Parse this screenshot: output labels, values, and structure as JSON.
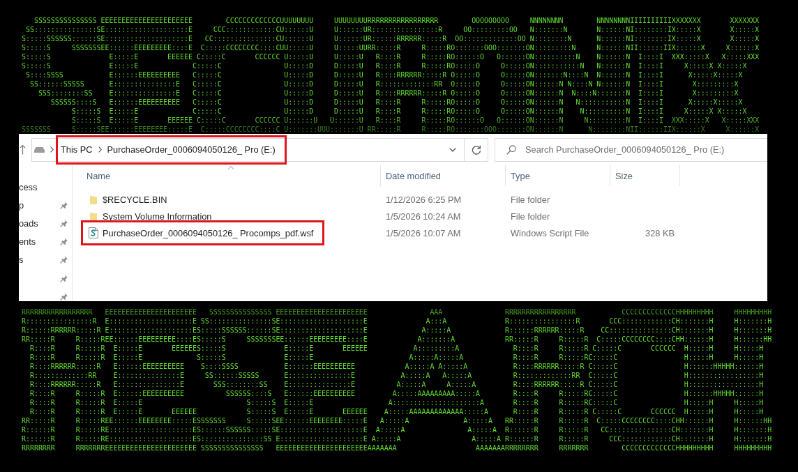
{
  "ascii_art_top": {
    "lines": [
      "   SSSSSSSSSSSSSSS EEEEEEEEEEEEEEEEEEEEEE        CCCCCCCCCCCCCUUUUUUUU     UUUUUUUURRRRRRRRRRRRRRRRR        OOOOOOOOO     NNNNNNNN        NNNNNNNNIIIIIIIIIIXXXXXXX       XXXXXXX",
      " SS:::::::::::::::SE::::::::::::::::::::E     CCC::::::::::::CU::::::U     U::::::UR::::::::::::::::R     OO:::::::::OO   N:::::::N       N::::::NI::::::::IX:::::X       X:::::X",
      "S:::::SSSSSS::::::SE::::::::::::::::::::E   CC:::::::::::::::CU::::::U     U::::::UR::::::RRRRRR:::::R  OO:::::::::::::OO N::::::::N      N::::::NI::::::::IX:::::X       X:::::X",
      "S:::::S     SSSSSSSEE::::::EEEEEEEEE::::E  C:::::CCCCCCCC::::CUU:::::U     U:::::UURR:::::R     R:::::RO:::::::OOO:::::::ON:::::::::N     N::::::NII::::::IIX::::::X     X::::::X",
      "S:::::S              E:::::E       EEEEEE C:::::C       CCCCCC U:::::U     U:::::U   R::::R     R:::::RO::::::O   O::::::ON::::::::::N    N::::::N  I::::I  XXX:::::X   X:::::XXX",
      "S:::::S              E:::::E             C:::::C               U:::::D     D:::::U   R::::R     R:::::RO:::::O     O:::::ON:::::::::::N   N::::::N  I::::I     X:::::X X:::::X",
      " S::::SSSS           E::::::EEEEEEEEEE   C:::::C               U:::::D     D:::::U   R::::RRRRRR:::::R O:::::O     O:::::ON:::::::N::::N  N::::::N  I::::I      X:::::X:::::X",
      "  SS::::::SSSSS      E:::::::::::::::E   C:::::C               U:::::D     D:::::U   R:::::::::::::RR  O:::::O     O:::::ON::::::N N::::N N::::::N  I::::I       X:::::::::X",
      "    SSS::::::::SS    E:::::::::::::::E   C:::::C               U:::::D     D:::::U   R::::RRRRRR:::::R O:::::O     O:::::ON::::::N  N::::N:::::::N  I::::I       X:::::::::X",
      "       SSSSSS::::S   E::::::EEEEEEEEEE   C:::::C               U:::::D     D:::::U   R::::R     R:::::RO:::::O     O:::::ON::::::N   N:::::::::::N  I::::I      X:::::X:::::X",
      "            S:::::S  E:::::E             C:::::C               U:::::D     D:::::U   R::::R     R:::::RO:::::O     O:::::ON::::::N    N::::::::::N  I::::I     X:::::X X:::::X",
      "            S:::::S  E:::::E       EEEEEE C:::::C       CCCCCC U::::::U   U::::::U   R::::R     R:::::RO::::::O   O::::::ON::::::N     N:::::::::N  I::::I  XXX:::::X   X:::::XXX",
      "SSSSSSS     S:::::SEE::::::EEEEEEEE:::::E  C:::::CCCCCCCC::::C U:::::::UUU:::::::U RR:::::R     R:::::RO:::::::OOO:::::::ON::::::N      N::::::::NII::::::IIX::::::X     X::::::X"
    ]
  },
  "explorer": {
    "address_bar": {
      "highlighted": true,
      "breadcrumbs": [
        "This PC",
        "PurchaseOrder_0006094050126_ Pro (E:)"
      ]
    },
    "search": {
      "placeholder": "Search PurchaseOrder_0006094050126_ Pro (E:)"
    },
    "navigation_pane": {
      "items": [
        {
          "label": "cess",
          "pinned": false
        },
        {
          "label": "p",
          "pinned": true
        },
        {
          "label": "oads",
          "pinned": true
        },
        {
          "label": "ents",
          "pinned": true
        },
        {
          "label": "s",
          "pinned": true
        },
        {
          "pinned": true
        },
        {
          "pinned": true
        }
      ]
    },
    "columns": [
      {
        "label": "Name",
        "sorted": true
      },
      {
        "label": "Date modified",
        "sorted": false
      },
      {
        "label": "Type",
        "sorted": false
      },
      {
        "label": "Size",
        "sorted": false
      }
    ],
    "files": [
      {
        "kind": "folder",
        "name": "$RECYCLE.BIN",
        "date_modified": "1/12/2026 6:25 PM",
        "type": "File folder",
        "highlighted": false
      },
      {
        "kind": "folder",
        "name": "System Volume Information",
        "date_modified": "1/5/2026 10:24 AM",
        "type": "File folder",
        "highlighted": false
      },
      {
        "kind": "script",
        "name": "PurchaseOrder_0006094050126_ Procomps_pdf.wsf",
        "date_modified": "1/5/2026 10:07 AM",
        "type": "Windows Script File",
        "size": "328 KB",
        "highlighted": true
      }
    ]
  },
  "ascii_art_bottom": {
    "lines": [
      "RRRRRRRRRRRRRRRRR   EEEEEEEEEEEEEEEEEEEEEE   SSSSSSSSSSSSSSS EEEEEEEEEEEEEEEEEEEEEE               AAA               RRRRRRRRRRRRRRRRR           CCCCCCCCCCCCCHHHHHHHHH     HHHHHHHHH",
      "R::::::::::::::::R  E::::::::::::::::::::E SS:::::::::::::::SE::::::::::::::::::::E              A:::A              R::::::::::::::::R       CCC::::::::::::CH:::::::H     H:::::::H",
      "R::::::RRRRRR:::::R E::::::::::::::::::::ES:::::SSSSSS::::::SE::::::::::::::::::::E             A:::::A             R::::::RRRRRR:::::R    CC:::::::::::::::CH:::::::H     H:::::::H",
      "RR:::::R     R:::::REE::::::EEEEEEEEE::::ES:::::S     SSSSSSSEE::::::EEEEEEEEE::::E            A:::::::A            RR:::::R     R:::::R  C:::::CCCCCCCC::::CHH::::::H     H::::::HH",
      "  R::::R     R:::::R  E:::::E       EEEEEES:::::S              E:::::E       EEEEEE           A:::::::::A             R::::R     R:::::R C:::::C       CCCCCC  H:::::H     H:::::H",
      "  R::::R     R:::::R  E:::::E             S:::::S              E:::::E                       A:::::A:::::A            R::::R     R:::::RC:::::C                H:::::H     H:::::H",
      "  R::::RRRRRR:::::R   E::::::EEEEEEEEEE    S::::SSSS           E::::::EEEEEEEEEE            A:::::A A:::::A           R::::RRRRRR:::::R C:::::C                H::::::HHHHH::::::H",
      "  R:::::::::::::RR    E:::::::::::::::E     SS::::::SSSSS      E:::::::::::::::E           A:::::A   A:::::A          R:::::::::::::RR  C:::::C                H:::::::::::::::::H",
      "  R::::RRRRRR:::::R   E:::::::::::::::E       SSS::::::::SS    E:::::::::::::::E          A:::::A     A:::::A         R::::RRRRRR:::::R C:::::C                H:::::::::::::::::H",
      "  R::::R     R:::::R  E::::::EEEEEEEEEE          SSSSSS::::S   E::::::EEEEEEEEEE         A:::::AAAAAAAAA:::::A        R::::R     R:::::RC:::::C                H::::::HHHHH::::::H",
      "  R::::R     R:::::R  E:::::E                         S:::::S  E:::::E                  A:::::::::::::::::::::A       R::::R     R:::::RC:::::C                H:::::H     H:::::H",
      "  R::::R     R:::::R  E:::::E       EEEEEE            S:::::S  E:::::E       EEEEEE    A:::::AAAAAAAAAAAAA:::::A      R::::R     R:::::R C:::::C       CCCCCC  H:::::H     H:::::H",
      "RR:::::R     R:::::REE::::::EEEEEEEE:::::ESSSSSSS     S:::::SEE::::::EEEEEEEE:::::E   A:::::A             A:::::A   RR:::::R     R:::::R  C:::::CCCCCCCC::::CHH::::::H     H::::::HH",
      "R::::::R     R:::::RE::::::::::::::::::::ES::::::SSSSSS:::::SE::::::::::::::::::::E  A:::::A               A:::::A  R::::::R     R:::::R   CC:::::::::::::::CH:::::::H     H:::::::H",
      "R::::::R     R:::::RE::::::::::::::::::::ES:::::::::::::::SS E::::::::::::::::::::E A:::::A                 A:::::A R::::::R     R:::::R     CCC::::::::::::CH:::::::H     H:::::::H",
      "RRRRRRRR     RRRRRRREEEEEEEEEEEEEEEEEEEEEE SSSSSSSSSSSSSSS   EEEEEEEEEEEEEEEEEEEEEEAAAAAAA                   AAAAAAARRRRRRRR     RRRRRRR        CCCCCCCCCCCCCHHHHHHHHH     HHHHHHHHH"
    ]
  }
}
